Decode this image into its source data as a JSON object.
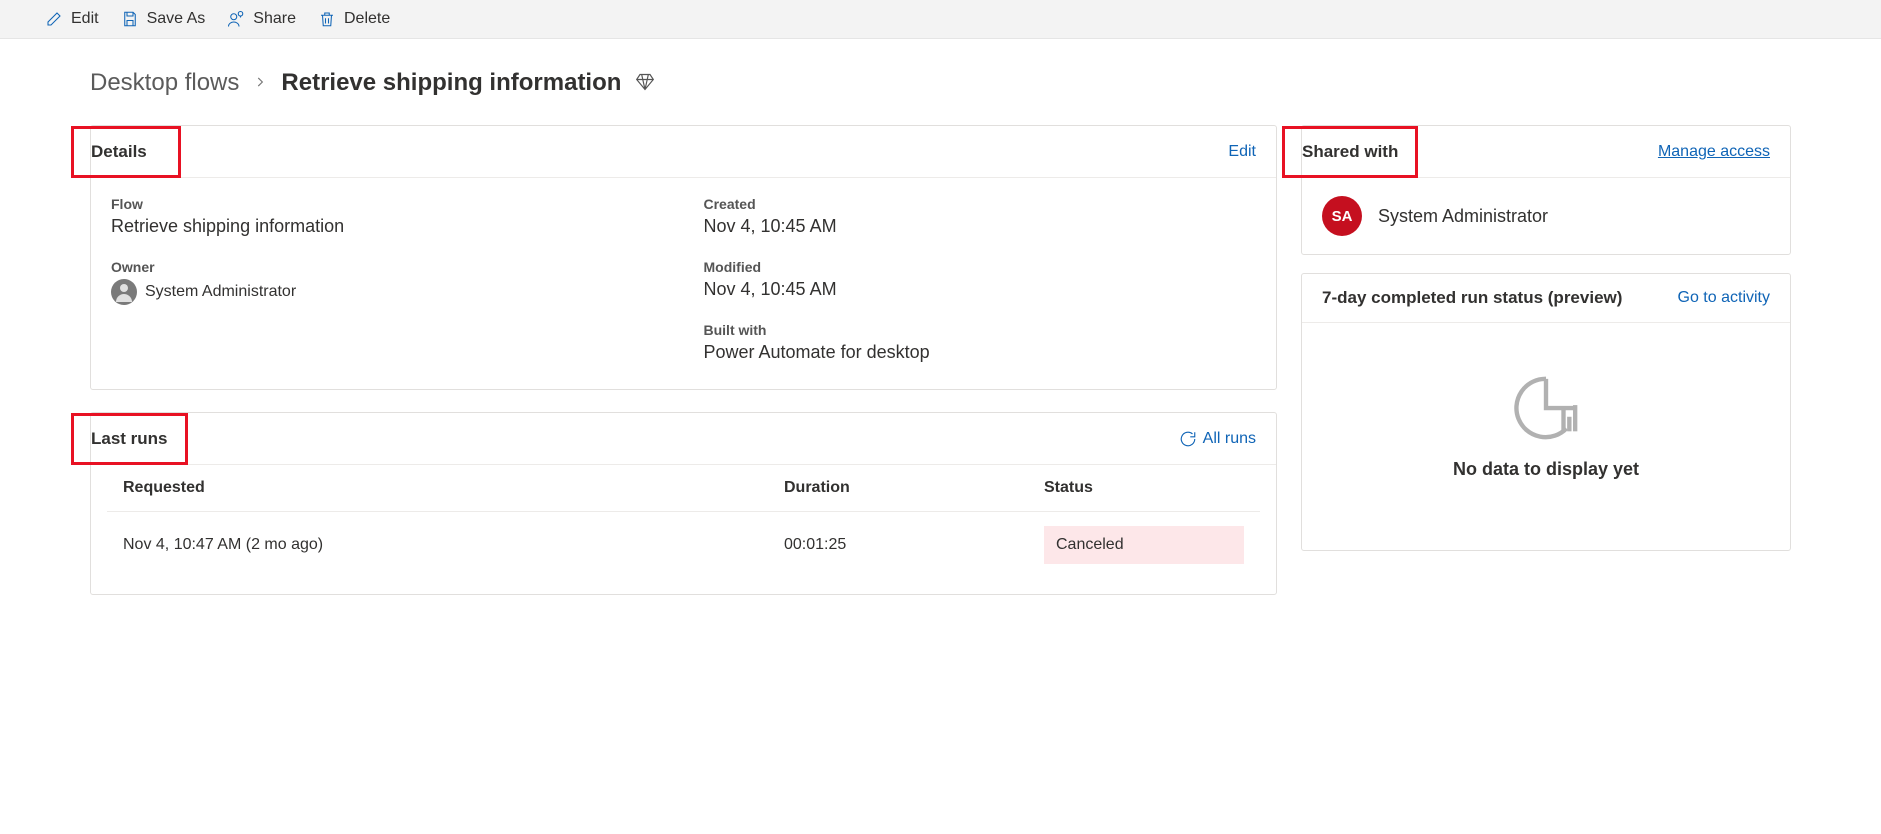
{
  "toolbar": {
    "edit": "Edit",
    "saveAs": "Save As",
    "share": "Share",
    "delete": "Delete"
  },
  "breadcrumb": {
    "root": "Desktop flows",
    "current": "Retrieve shipping information"
  },
  "details": {
    "title": "Details",
    "editLink": "Edit",
    "flowLabel": "Flow",
    "flowValue": "Retrieve shipping information",
    "ownerLabel": "Owner",
    "ownerName": "System Administrator",
    "createdLabel": "Created",
    "createdValue": "Nov 4, 10:45 AM",
    "modifiedLabel": "Modified",
    "modifiedValue": "Nov 4, 10:45 AM",
    "builtWithLabel": "Built with",
    "builtWithValue": "Power Automate for desktop"
  },
  "lastRuns": {
    "title": "Last runs",
    "allRunsLink": "All runs",
    "columns": {
      "requested": "Requested",
      "duration": "Duration",
      "status": "Status"
    },
    "rows": [
      {
        "requested": "Nov 4, 10:47 AM (2 mo ago)",
        "duration": "00:01:25",
        "status": "Canceled"
      }
    ]
  },
  "sharedWith": {
    "title": "Shared with",
    "manageLink": "Manage access",
    "initials": "SA",
    "name": "System Administrator"
  },
  "runStatus": {
    "title": "7-day completed run status (preview)",
    "activityLink": "Go to activity",
    "emptyText": "No data to display yet"
  }
}
